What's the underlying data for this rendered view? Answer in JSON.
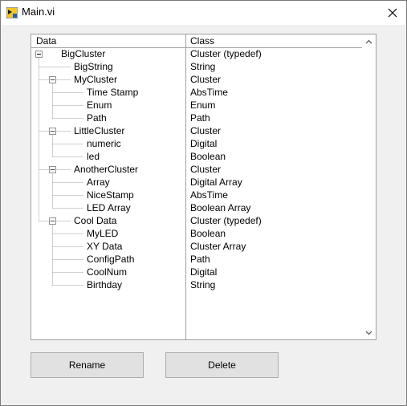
{
  "window": {
    "title": "Main.vi",
    "icon": "labview-vi-icon",
    "close_icon": "close-icon"
  },
  "tree": {
    "columns": {
      "data": "Data",
      "class": "Class"
    },
    "rows": [
      {
        "name": "BigCluster",
        "class": "Cluster (typedef)",
        "level": 0,
        "expanded": true
      },
      {
        "name": "BigString",
        "class": "String",
        "level": 1
      },
      {
        "name": "MyCluster",
        "class": "Cluster",
        "level": 1,
        "expanded": true
      },
      {
        "name": "Time Stamp",
        "class": "AbsTime",
        "level": 2
      },
      {
        "name": "Enum",
        "class": "Enum",
        "level": 2
      },
      {
        "name": "Path",
        "class": "Path",
        "level": 2
      },
      {
        "name": "LittleCluster",
        "class": "Cluster",
        "level": 1,
        "expanded": true
      },
      {
        "name": "numeric",
        "class": "Digital",
        "level": 2
      },
      {
        "name": "led",
        "class": "Boolean",
        "level": 2
      },
      {
        "name": "AnotherCluster",
        "class": "Cluster",
        "level": 1,
        "expanded": true
      },
      {
        "name": "Array",
        "class": "Digital Array",
        "level": 2
      },
      {
        "name": "NiceStamp",
        "class": "AbsTime",
        "level": 2
      },
      {
        "name": "LED Array",
        "class": "Boolean Array",
        "level": 2
      },
      {
        "name": "Cool Data",
        "class": "Cluster (typedef)",
        "level": 1,
        "expanded": true
      },
      {
        "name": "MyLED",
        "class": "Boolean",
        "level": 2
      },
      {
        "name": "XY Data",
        "class": "Cluster Array",
        "level": 2
      },
      {
        "name": "ConfigPath",
        "class": "Path",
        "level": 2
      },
      {
        "name": "CoolNum",
        "class": "Digital",
        "level": 2
      },
      {
        "name": "Birthday",
        "class": "String",
        "level": 2
      }
    ]
  },
  "buttons": {
    "rename": "Rename",
    "delete": "Delete"
  }
}
